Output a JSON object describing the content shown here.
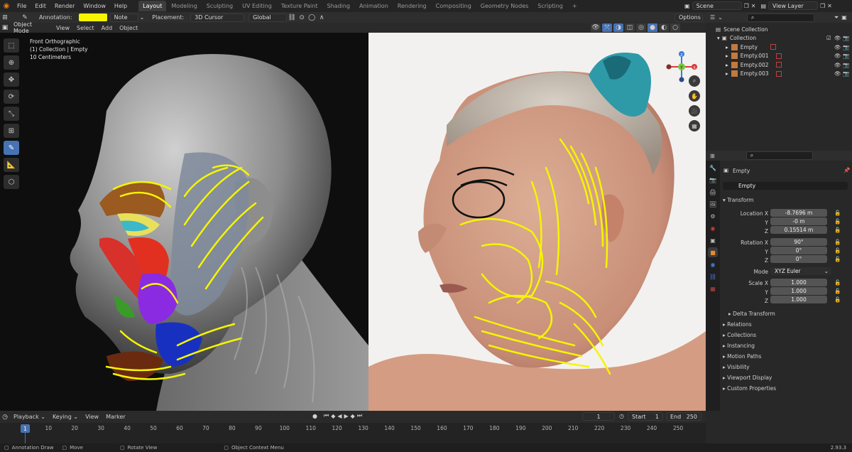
{
  "menu": [
    "File",
    "Edit",
    "Render",
    "Window",
    "Help"
  ],
  "workspaces": [
    "Layout",
    "Modeling",
    "Sculpting",
    "UV Editing",
    "Texture Paint",
    "Shading",
    "Animation",
    "Rendering",
    "Compositing",
    "Geometry Nodes",
    "Scripting"
  ],
  "active_workspace": "Layout",
  "scene_name": "Scene",
  "view_layer": "View Layer",
  "tool_header": {
    "annotation_label": "Annotation:",
    "annotation_color": "#f5f500",
    "note_value": "Note",
    "placement_label": "Placement:",
    "placement_value": "3D Cursor",
    "orientation": "Global",
    "options": "Options"
  },
  "view_header": {
    "mode": "Object Mode",
    "items": [
      "View",
      "Select",
      "Add",
      "Object"
    ]
  },
  "viewport_info": {
    "line1": "Front Orthographic",
    "line2": "(1) Collection | Empty",
    "line3": "10 Centimeters"
  },
  "gizmo": {
    "y_label": "Y",
    "z_label": "Z",
    "x_label": "X"
  },
  "outliner": {
    "root": "Scene Collection",
    "collection": "Collection",
    "objects": [
      "Empty",
      "Empty.001",
      "Empty.002",
      "Empty.003"
    ]
  },
  "properties": {
    "object_name": "Empty",
    "data_name": "Empty",
    "transform_title": "Transform",
    "location_label": "Location X",
    "location": [
      "-8.7696 m",
      "-0 m",
      "0.15514 m"
    ],
    "rotation_label": "Rotation X",
    "rotation": [
      "90°",
      "0°",
      "0°"
    ],
    "mode_label": "Mode",
    "mode_value": "XYZ Euler",
    "scale_label": "Scale X",
    "scale": [
      "1.000",
      "1.000",
      "1.000"
    ],
    "y_label": "Y",
    "z_label": "Z",
    "delta_transform": "Delta Transform",
    "sections": [
      "Relations",
      "Collections",
      "Instancing",
      "Motion Paths",
      "Visibility",
      "Viewport Display",
      "Custom Properties"
    ]
  },
  "timeline": {
    "menu": [
      "Playback",
      "Keying",
      "View",
      "Marker"
    ],
    "current_frame": "1",
    "start_label": "Start",
    "start": "1",
    "end_label": "End",
    "end": "250",
    "ticks": [
      "1",
      "10",
      "20",
      "30",
      "40",
      "50",
      "60",
      "70",
      "80",
      "90",
      "100",
      "110",
      "120",
      "130",
      "140",
      "150",
      "160",
      "170",
      "180",
      "190",
      "200",
      "210",
      "220",
      "230",
      "240",
      "250"
    ]
  },
  "status": {
    "items": [
      "Annotation Draw",
      "Move",
      "Rotate View",
      "Object Context Menu"
    ],
    "version": "2.93.3"
  },
  "colors": {
    "accent": "#4772b3",
    "annotation": "#f5f500",
    "background": "#1d1d1d"
  }
}
